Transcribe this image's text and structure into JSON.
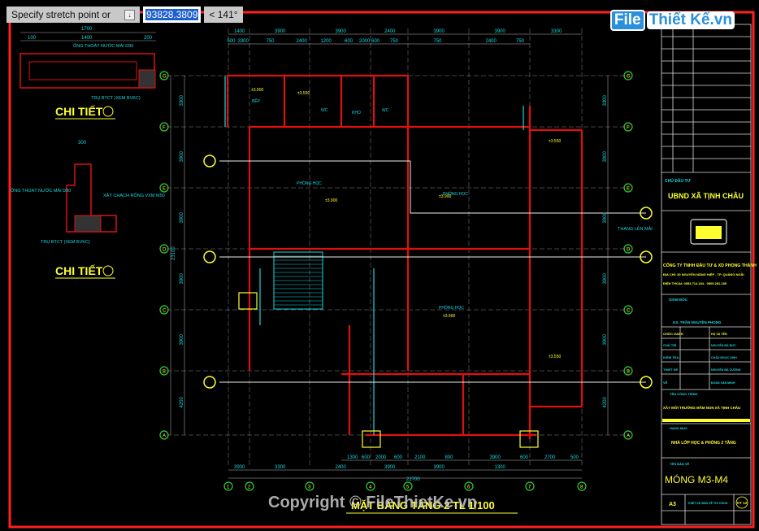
{
  "command_bar": {
    "prompt": "Specify stretch point or",
    "prompt_icon": "dropdown-arrow-icon",
    "distance_value": "93828.3809",
    "angle_value": "< 141°"
  },
  "watermark": {
    "brand_left": "File",
    "brand_right": "Thiết Kế.vn",
    "copyright": "Copyright © FileThietKe.vn"
  },
  "colors": {
    "frame": "#ff2020",
    "wall": "#e01010",
    "cyan": "#19d7e0",
    "yellow": "#ffff30",
    "grid_bubble": "#30d030",
    "line": "#d0d0d0"
  },
  "details": {
    "detail_1_title": "CHI TIẾT",
    "detail_2_title": "CHI TIẾT",
    "dim_1700": "1700",
    "dim_100": "100",
    "dim_1400": "1400",
    "dim_200": "200",
    "dim_300": "300",
    "pipe_note": "ỐNG THOÁT NƯỚC MÁI D90",
    "column_note": "TRỤ BTCT (XEM BVKC)",
    "wall_note": "XÂY CHẠCH RỖNG VXM M50"
  },
  "plan": {
    "title": "MẶT BẰNG TẦNG 2 TL 1/100",
    "top_dims_row1": [
      "1400",
      "3900",
      "3900",
      "2400",
      "3900",
      "3900",
      "3300"
    ],
    "top_dims_row2": [
      "500",
      "3300",
      "750",
      "2400",
      "1200",
      "600",
      "2000",
      "600",
      "750",
      "750",
      "2400",
      "750"
    ],
    "bottom_dims_row1": [
      "1300",
      "600",
      "2000",
      "600",
      "2100",
      "800",
      "3900",
      "600",
      "2700",
      "500"
    ],
    "bottom_dims_row2": [
      "3900",
      "3300",
      "2400",
      "3900",
      "3900",
      "1300"
    ],
    "bottom_total": "22700",
    "left_dims": [
      "3300",
      "3900",
      "3900",
      "3900",
      "3900",
      "4200"
    ],
    "left_total": "23100",
    "right_dims": [
      "3300",
      "3900",
      "3900",
      "3900",
      "3900",
      "4200"
    ],
    "right_note": "THANG LÊN MÁI",
    "grid_rows": [
      "G",
      "F",
      "E",
      "D",
      "C",
      "B",
      "A"
    ],
    "grid_cols": [
      "1",
      "2",
      "3",
      "4",
      "5",
      "6",
      "7",
      "8"
    ],
    "rooms": [
      "PHÒNG HỌC",
      "PHÒNG HỌC",
      "PHÒNG HỌC",
      "KHO",
      "WC",
      "WC",
      "BẾP"
    ],
    "levels": [
      "±3.900",
      "±3.550",
      "±3.900",
      "±3.900",
      "±3.550",
      "±3.550",
      "±3.900"
    ]
  },
  "title_block": {
    "client_label": "CHỦ ĐẦU TƯ",
    "client": "UBND XÃ TỊNH CHÂU",
    "company": "CÔNG TY TNHH ĐẦU TƯ & XD PHONG THÀNH",
    "address": "ĐỊA CHỈ: 30 NGUYỄN NĂNG HIỆP - TP. QUẢNG NGÃI",
    "phone": "ĐIỆN THOẠI: 0553.714.184 - 0905.281.189",
    "director_label": "GIÁM ĐỐC",
    "director": "KS. TRẦN NGUYÊN PHONG",
    "rows": [
      "CHỨC DANH",
      "CHỦ TRÌ",
      "KIỂM TRA",
      "THIẾT KẾ",
      "VẼ"
    ],
    "names": [
      "HỌ VÀ TÊN",
      "NGUYỄN BÁ ĐỨC",
      "CHÂU NGỌC VINH",
      "NGUYỄN BÁ CƯỜNG",
      "ĐOÀN VĂN MINH"
    ],
    "project_label": "TÊN CÔNG TRÌNH",
    "project": "XÂY MỚI TRƯỜNG MẦM NON XÃ TỊNH CHÂU",
    "item_label": "HẠNG MỤC",
    "item": "NHÀ LỚP HỌC & PHÒNG 2 TẦNG",
    "drawing_label": "TÊN BẢN VẼ",
    "drawing": "MÓNG M3-M4",
    "sheet_size": "A3",
    "stage": "THIẾT KẾ BẢN VẼ THI CÔNG",
    "sheet_no": "KT 12"
  }
}
